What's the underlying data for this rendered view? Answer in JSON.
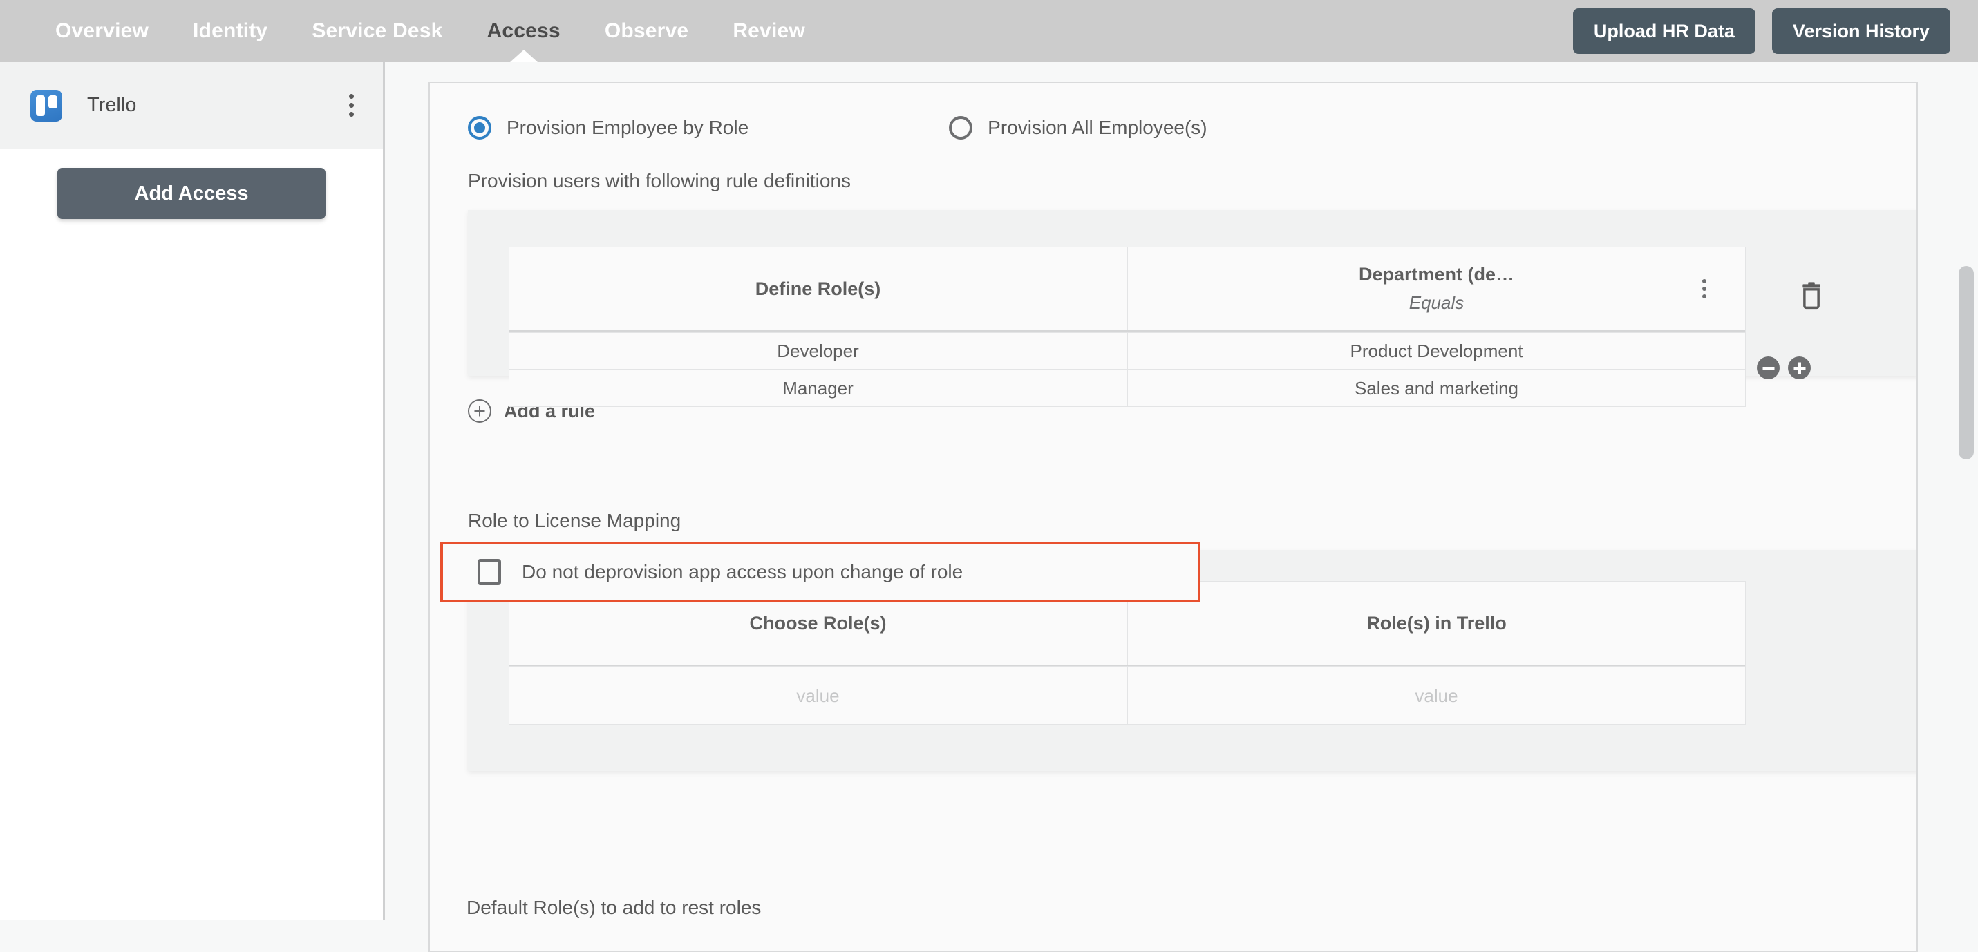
{
  "topnav": {
    "items": [
      {
        "label": "Overview",
        "active": false
      },
      {
        "label": "Identity",
        "active": false
      },
      {
        "label": "Service Desk",
        "active": false
      },
      {
        "label": "Access",
        "active": true
      },
      {
        "label": "Observe",
        "active": false
      },
      {
        "label": "Review",
        "active": false
      }
    ],
    "upload_hr_data_label": "Upload HR Data",
    "version_history_label": "Version History",
    "background_color": "#cccccc",
    "button_color": "#4b5a64"
  },
  "sidebar": {
    "app": {
      "name": "Trello",
      "logo_icon": "trello-icon",
      "menu_icon": "kebab-menu-icon"
    },
    "add_access_label": "Add Access"
  },
  "main": {
    "provision_mode": {
      "options": [
        {
          "label": "Provision Employee by Role",
          "selected": true
        },
        {
          "label": "Provision All Employee(s)",
          "selected": false
        }
      ],
      "accent_color": "#2f80c4"
    },
    "rules_section": {
      "title": "Provision users with following rule definitions",
      "table": {
        "columns": [
          {
            "title": "Define Role(s)",
            "subtitle": ""
          },
          {
            "title": "Department (de…",
            "subtitle": "Equals"
          }
        ],
        "rows": [
          [
            "Developer",
            "Product Development"
          ],
          [
            "Manager",
            "Sales and marketing"
          ]
        ]
      },
      "delete_icon": "trash-icon",
      "remove_row_icon": "minus-circle-icon",
      "add_row_icon": "plus-circle-icon",
      "column_menu_icon": "kebab-menu-icon"
    },
    "add_rule": {
      "label": "Add a rule",
      "icon": "plus-circle-icon"
    },
    "deprovision_option": {
      "label": "Do not deprovision app access upon change of role",
      "checked": false,
      "highlight_color": "#e8502e"
    },
    "license_section": {
      "title": "Role to License Mapping",
      "table": {
        "columns": [
          "Choose Role(s)",
          "Role(s) in Trello"
        ],
        "rows": [
          [
            "value",
            "value"
          ]
        ]
      }
    },
    "default_roles_label": "Default Role(s) to add to rest roles"
  },
  "scrollbar": {
    "thumb_color": "#c7c9cb"
  }
}
